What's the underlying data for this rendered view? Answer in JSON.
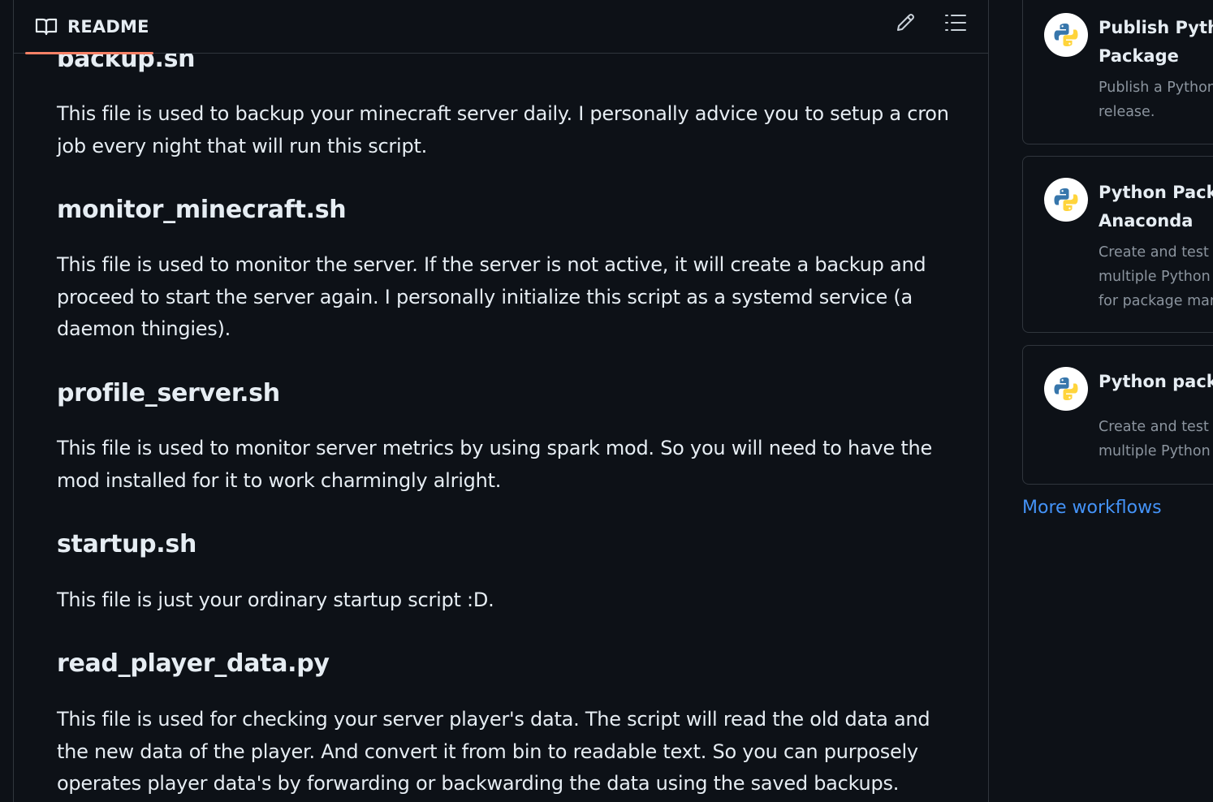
{
  "readme": {
    "tab_label": "README",
    "sections": [
      {
        "heading": "backup.sh",
        "body": "This file is used to backup your minecraft server daily. I personally advice you to setup a cron job every night that will run this script."
      },
      {
        "heading": "monitor_minecraft.sh",
        "body": "This file is used to monitor the server. If the server is not active, it will create a backup and proceed to start the server again. I personally initialize this script as a systemd service (a daemon thingies)."
      },
      {
        "heading": "profile_server.sh",
        "body": "This file is used to monitor server metrics by using spark mod. So you will need to have the mod installed for it to work charmingly alright."
      },
      {
        "heading": "startup.sh",
        "body": "This file is just your ordinary startup script :D."
      },
      {
        "heading": "read_player_data.py",
        "body": "This file is used for checking your server player's data. The script will read the old data and the new data of the player. And convert it from bin to readable text. So you can purposely operates player data's by forwarding or backwarding the data using the saved backups."
      }
    ]
  },
  "sidebar": {
    "workflows": [
      {
        "title_line1": "Publish Pytho",
        "title_line2": "Package",
        "desc_lines": [
          "Publish a Python",
          "release."
        ],
        "icon": "python-logo-icon"
      },
      {
        "title_line1": "Python Packa",
        "title_line2": "Anaconda",
        "desc_lines": [
          "Create and test a",
          "multiple Python",
          "for package man"
        ],
        "icon": "python-logo-icon"
      },
      {
        "title_line1": "Python packa",
        "title_line2": "",
        "desc_lines": [
          "Create and test a",
          "multiple Python"
        ],
        "icon": "python-logo-icon"
      }
    ],
    "more_link": "More workflows"
  },
  "colors": {
    "background": "#0d1117",
    "border": "#30363d",
    "text": "#e6edf3",
    "muted": "#8b949e",
    "link": "#4493f8",
    "tab_underline": "#f78166"
  },
  "icons": {
    "readme_tab": "book-icon",
    "edit": "pencil-icon",
    "outline": "list-unordered-icon"
  }
}
